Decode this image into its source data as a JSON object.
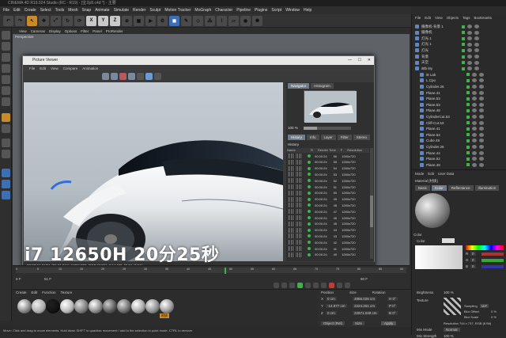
{
  "app": {
    "title": "CINEMA 4D R19.024 Studio (RC - R19) - [宝马i8.c4d *] - 主要",
    "menus": [
      "File",
      "Edit",
      "Create",
      "Select",
      "Tools",
      "Mesh",
      "Snap",
      "Animate",
      "Simulate",
      "Render",
      "Sculpt",
      "Motion Tracker",
      "MoGraph",
      "Character",
      "Pipeline",
      "Plugins",
      "Script",
      "Window",
      "Help"
    ]
  },
  "toolbar": {
    "axis_x": "X",
    "axis_y": "Y",
    "axis_z": "Z"
  },
  "viewport": {
    "menus": [
      "View",
      "Cameras",
      "Display",
      "Options",
      "Filter",
      "Panel",
      "ProRender"
    ],
    "label": "Perspective"
  },
  "picture_viewer": {
    "title": "Picture Viewer",
    "menus": [
      "File",
      "Edit",
      "View",
      "Compare",
      "Animation"
    ],
    "nav_tabs": [
      "Navigator",
      "Histogram"
    ],
    "zoom": "100 %",
    "history_tabs": [
      "History",
      "Info",
      "Layer",
      "Filter",
      "Stereo"
    ],
    "history_title": "History",
    "history_columns": [
      "Name",
      "R",
      "Render Time",
      "F",
      "Resolution"
    ],
    "history_rows": [
      {
        "time": "00:00:24",
        "f": "56",
        "res": "1280x720"
      },
      {
        "time": "00:00:24",
        "f": "55",
        "res": "1280x720"
      },
      {
        "time": "00:00:24",
        "f": "54",
        "res": "1280x720"
      },
      {
        "time": "00:00:24",
        "f": "53",
        "res": "1280x720"
      },
      {
        "time": "00:00:24",
        "f": "52",
        "res": "1280x720"
      },
      {
        "time": "00:00:24",
        "f": "51",
        "res": "1280x720"
      },
      {
        "time": "00:00:24",
        "f": "50",
        "res": "1280x720"
      },
      {
        "time": "00:00:24",
        "f": "49",
        "res": "1280x720"
      },
      {
        "time": "00:00:24",
        "f": "48",
        "res": "1280x720"
      },
      {
        "time": "00:00:24",
        "f": "47",
        "res": "1280x720"
      },
      {
        "time": "00:00:24",
        "f": "46",
        "res": "1280x720"
      },
      {
        "time": "00:00:24",
        "f": "45",
        "res": "1280x720"
      },
      {
        "time": "00:00:24",
        "f": "44",
        "res": "1280x720"
      },
      {
        "time": "00:00:24",
        "f": "43",
        "res": "1280x720"
      },
      {
        "time": "00:00:24",
        "f": "42",
        "res": "1280x720"
      },
      {
        "time": "00:00:24",
        "f": "41",
        "res": "1280x720"
      },
      {
        "time": "00:00:24",
        "f": "40",
        "res": "1280x720"
      }
    ],
    "status": "00:20:24 51/51 (55 F)  Size: 1280x720, RGB (8 Bit), 2.64 MB, (F 51 of 51)",
    "frame_end": "51 F",
    "frame_start": "0 F"
  },
  "overlay_text": "i7 12650H  20分25秒",
  "timeline": {
    "start": "0 F",
    "end": "90 F",
    "current": "51 F",
    "ticks": [
      "0",
      "5",
      "10",
      "15",
      "20",
      "25",
      "30",
      "35",
      "40",
      "45",
      "50",
      "55",
      "60",
      "65",
      "70",
      "75",
      "80",
      "85",
      "90"
    ]
  },
  "material_manager": {
    "menus": [
      "Create",
      "Edit",
      "Function",
      "Texture"
    ],
    "selected_label": "材质"
  },
  "coords": {
    "headers": [
      "Position",
      "Size",
      "Rotation"
    ],
    "rows": [
      {
        "axis": "X",
        "pos": "0 cm",
        "size": "4866.028 cm",
        "rot": "H 0°"
      },
      {
        "axis": "Y",
        "pos": "-14.977 cm",
        "size": "2324.251 cm",
        "rot": "P 0°"
      },
      {
        "axis": "Z",
        "pos": "0 cm",
        "size": "22671.049 cm",
        "rot": "B 0°"
      }
    ],
    "mode": "Object (Rel)",
    "size_mode": "Size",
    "apply": "Apply"
  },
  "status_bar": "Move: Click and drag to move elements. Hold down SHIFT to quantize movement / add to the selection in point mode, CTRL to remove.",
  "right_panel": {
    "menus": [
      "File",
      "Edit",
      "View",
      "Objects",
      "Tags",
      "Bookmarks"
    ],
    "objects": [
      "摄像机-背景 1",
      "摄像机",
      "灯光.1",
      "灯光 1",
      "灯光",
      "背景",
      "天空",
      "i8lb i8y",
      "i8 Lab",
      "L.Cpo",
      "Cylinder.26",
      "Plane.41",
      "Plane.53",
      "Plane.53",
      "Plane.48",
      "CylinderCut.53",
      "Cliff-Cut.53",
      "Plane.41",
      "Plane.54",
      "Cube.49",
      "Cylinder.26",
      "Plane.44",
      "Plane.52",
      "Plane.48"
    ],
    "attr_menus": [
      "Mode",
      "Edit",
      "User Data"
    ],
    "material_name": "Material [材质]",
    "attr_tabs": [
      "Basic",
      "Color",
      "Reflectance",
      "Illumination"
    ],
    "color_label": "Color",
    "color_section": "Color",
    "brightness_label": "Brightness",
    "brightness_value": "100 %",
    "texture_label": "Texture",
    "sampling_label": "Sampling",
    "sampling_value": "MIP",
    "blur_offset_label": "Blur Offset",
    "blur_offset_value": "0 %",
    "blur_scale_label": "Blur Scale",
    "blur_scale_value": "0 %",
    "resolution_text": "Resolution 744 x 737, RGB (8 Bit)",
    "mix_mode_label": "Mix Mode",
    "mix_mode_value": "Normal",
    "mix_strength_label": "Mix Strength",
    "mix_strength_value": "100 %",
    "rgb": [
      {
        "ch": "R",
        "val": "0"
      },
      {
        "ch": "G",
        "val": "0"
      },
      {
        "ch": "B",
        "val": "0"
      }
    ]
  }
}
